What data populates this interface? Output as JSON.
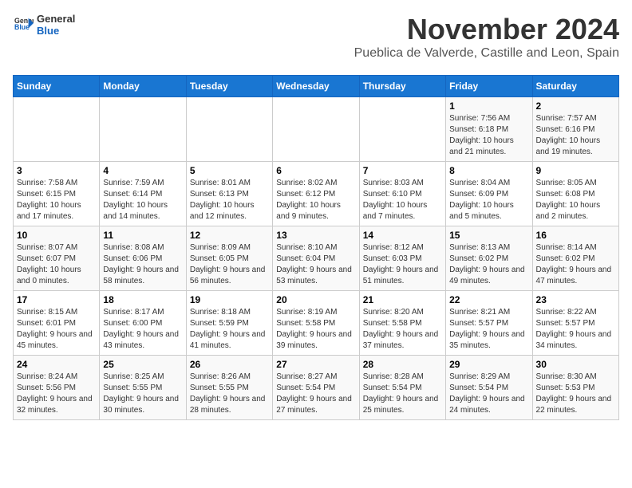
{
  "logo": {
    "general": "General",
    "blue": "Blue"
  },
  "title": "November 2024",
  "location": "Pueblica de Valverde, Castille and Leon, Spain",
  "weekdays": [
    "Sunday",
    "Monday",
    "Tuesday",
    "Wednesday",
    "Thursday",
    "Friday",
    "Saturday"
  ],
  "weeks": [
    [
      {
        "day": "",
        "info": ""
      },
      {
        "day": "",
        "info": ""
      },
      {
        "day": "",
        "info": ""
      },
      {
        "day": "",
        "info": ""
      },
      {
        "day": "",
        "info": ""
      },
      {
        "day": "1",
        "info": "Sunrise: 7:56 AM\nSunset: 6:18 PM\nDaylight: 10 hours and 21 minutes."
      },
      {
        "day": "2",
        "info": "Sunrise: 7:57 AM\nSunset: 6:16 PM\nDaylight: 10 hours and 19 minutes."
      }
    ],
    [
      {
        "day": "3",
        "info": "Sunrise: 7:58 AM\nSunset: 6:15 PM\nDaylight: 10 hours and 17 minutes."
      },
      {
        "day": "4",
        "info": "Sunrise: 7:59 AM\nSunset: 6:14 PM\nDaylight: 10 hours and 14 minutes."
      },
      {
        "day": "5",
        "info": "Sunrise: 8:01 AM\nSunset: 6:13 PM\nDaylight: 10 hours and 12 minutes."
      },
      {
        "day": "6",
        "info": "Sunrise: 8:02 AM\nSunset: 6:12 PM\nDaylight: 10 hours and 9 minutes."
      },
      {
        "day": "7",
        "info": "Sunrise: 8:03 AM\nSunset: 6:10 PM\nDaylight: 10 hours and 7 minutes."
      },
      {
        "day": "8",
        "info": "Sunrise: 8:04 AM\nSunset: 6:09 PM\nDaylight: 10 hours and 5 minutes."
      },
      {
        "day": "9",
        "info": "Sunrise: 8:05 AM\nSunset: 6:08 PM\nDaylight: 10 hours and 2 minutes."
      }
    ],
    [
      {
        "day": "10",
        "info": "Sunrise: 8:07 AM\nSunset: 6:07 PM\nDaylight: 10 hours and 0 minutes."
      },
      {
        "day": "11",
        "info": "Sunrise: 8:08 AM\nSunset: 6:06 PM\nDaylight: 9 hours and 58 minutes."
      },
      {
        "day": "12",
        "info": "Sunrise: 8:09 AM\nSunset: 6:05 PM\nDaylight: 9 hours and 56 minutes."
      },
      {
        "day": "13",
        "info": "Sunrise: 8:10 AM\nSunset: 6:04 PM\nDaylight: 9 hours and 53 minutes."
      },
      {
        "day": "14",
        "info": "Sunrise: 8:12 AM\nSunset: 6:03 PM\nDaylight: 9 hours and 51 minutes."
      },
      {
        "day": "15",
        "info": "Sunrise: 8:13 AM\nSunset: 6:02 PM\nDaylight: 9 hours and 49 minutes."
      },
      {
        "day": "16",
        "info": "Sunrise: 8:14 AM\nSunset: 6:02 PM\nDaylight: 9 hours and 47 minutes."
      }
    ],
    [
      {
        "day": "17",
        "info": "Sunrise: 8:15 AM\nSunset: 6:01 PM\nDaylight: 9 hours and 45 minutes."
      },
      {
        "day": "18",
        "info": "Sunrise: 8:17 AM\nSunset: 6:00 PM\nDaylight: 9 hours and 43 minutes."
      },
      {
        "day": "19",
        "info": "Sunrise: 8:18 AM\nSunset: 5:59 PM\nDaylight: 9 hours and 41 minutes."
      },
      {
        "day": "20",
        "info": "Sunrise: 8:19 AM\nSunset: 5:58 PM\nDaylight: 9 hours and 39 minutes."
      },
      {
        "day": "21",
        "info": "Sunrise: 8:20 AM\nSunset: 5:58 PM\nDaylight: 9 hours and 37 minutes."
      },
      {
        "day": "22",
        "info": "Sunrise: 8:21 AM\nSunset: 5:57 PM\nDaylight: 9 hours and 35 minutes."
      },
      {
        "day": "23",
        "info": "Sunrise: 8:22 AM\nSunset: 5:57 PM\nDaylight: 9 hours and 34 minutes."
      }
    ],
    [
      {
        "day": "24",
        "info": "Sunrise: 8:24 AM\nSunset: 5:56 PM\nDaylight: 9 hours and 32 minutes."
      },
      {
        "day": "25",
        "info": "Sunrise: 8:25 AM\nSunset: 5:55 PM\nDaylight: 9 hours and 30 minutes."
      },
      {
        "day": "26",
        "info": "Sunrise: 8:26 AM\nSunset: 5:55 PM\nDaylight: 9 hours and 28 minutes."
      },
      {
        "day": "27",
        "info": "Sunrise: 8:27 AM\nSunset: 5:54 PM\nDaylight: 9 hours and 27 minutes."
      },
      {
        "day": "28",
        "info": "Sunrise: 8:28 AM\nSunset: 5:54 PM\nDaylight: 9 hours and 25 minutes."
      },
      {
        "day": "29",
        "info": "Sunrise: 8:29 AM\nSunset: 5:54 PM\nDaylight: 9 hours and 24 minutes."
      },
      {
        "day": "30",
        "info": "Sunrise: 8:30 AM\nSunset: 5:53 PM\nDaylight: 9 hours and 22 minutes."
      }
    ]
  ]
}
